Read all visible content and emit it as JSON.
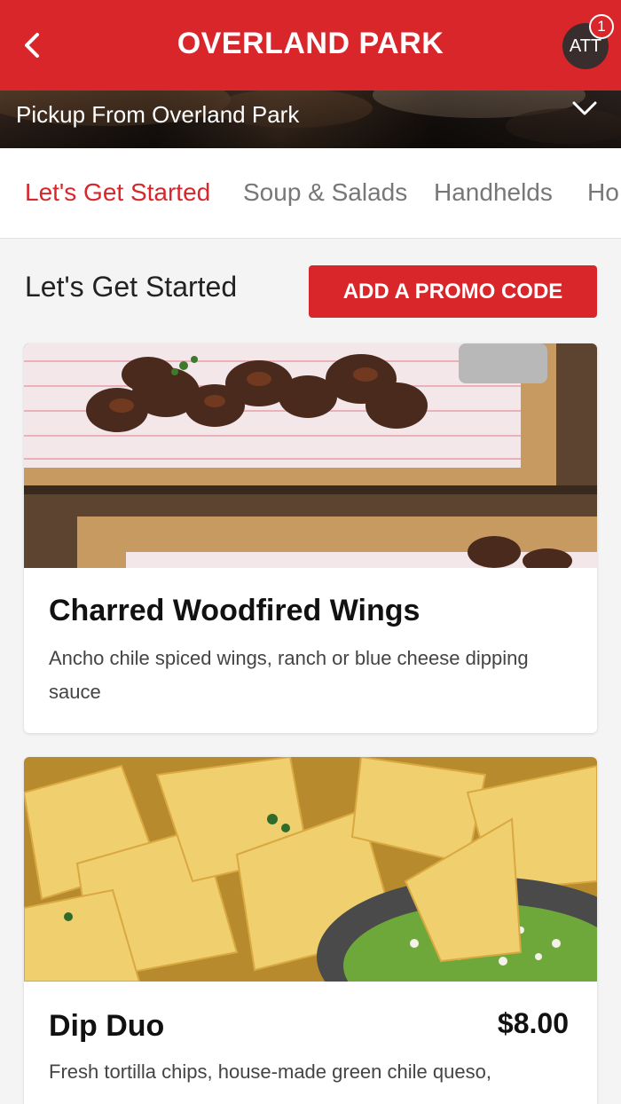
{
  "header": {
    "title": "OVERLAND PARK",
    "avatar_initials": "ATT",
    "notification_count": "1",
    "brand_color": "#d9262b"
  },
  "pickup": {
    "label": "Pickup From Overland Park"
  },
  "tabs": [
    {
      "label": "Let's Get Started",
      "active": true
    },
    {
      "label": "Soup & Salads"
    },
    {
      "label": "Handhelds"
    },
    {
      "label": "Ho"
    }
  ],
  "section": {
    "title": "Let's Get Started",
    "promo_label": "ADD A PROMO CODE"
  },
  "menu_items": [
    {
      "name": "Charred Woodfired Wings",
      "description": "Ancho chile spiced wings, ranch or blue cheese dipping sauce",
      "price": ""
    },
    {
      "name": "Dip Duo",
      "description": "Fresh tortilla chips, house-made green chile queso,",
      "price": "$8.00"
    }
  ]
}
